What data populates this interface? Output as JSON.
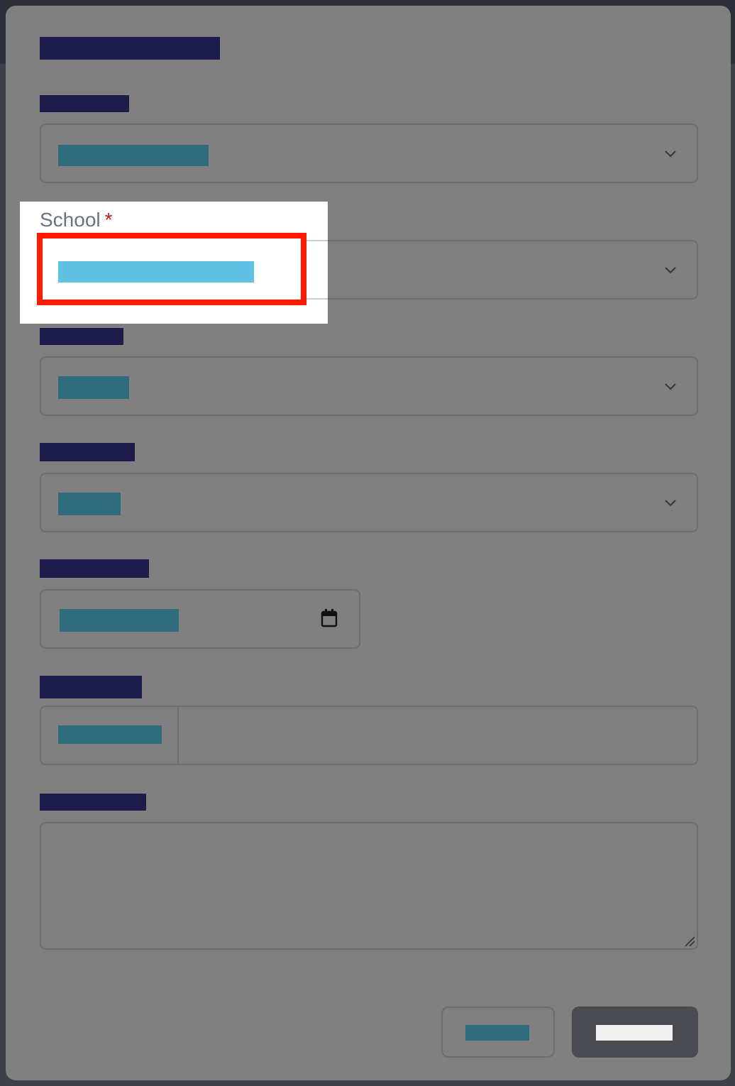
{
  "modal": {
    "school_field": {
      "label": "School",
      "required_mark": "*"
    }
  },
  "icons": {
    "chevron": "chevron-down-icon",
    "calendar": "calendar-icon",
    "resize": "resize-handle-icon"
  },
  "colors": {
    "overlay": "#808080",
    "highlight_border": "#ff1a00",
    "redacted_label": "#1e1c4a",
    "redacted_value": "#2f6b7a",
    "selected_value": "#5fc2e2",
    "submit_button": "#4a4b50"
  }
}
